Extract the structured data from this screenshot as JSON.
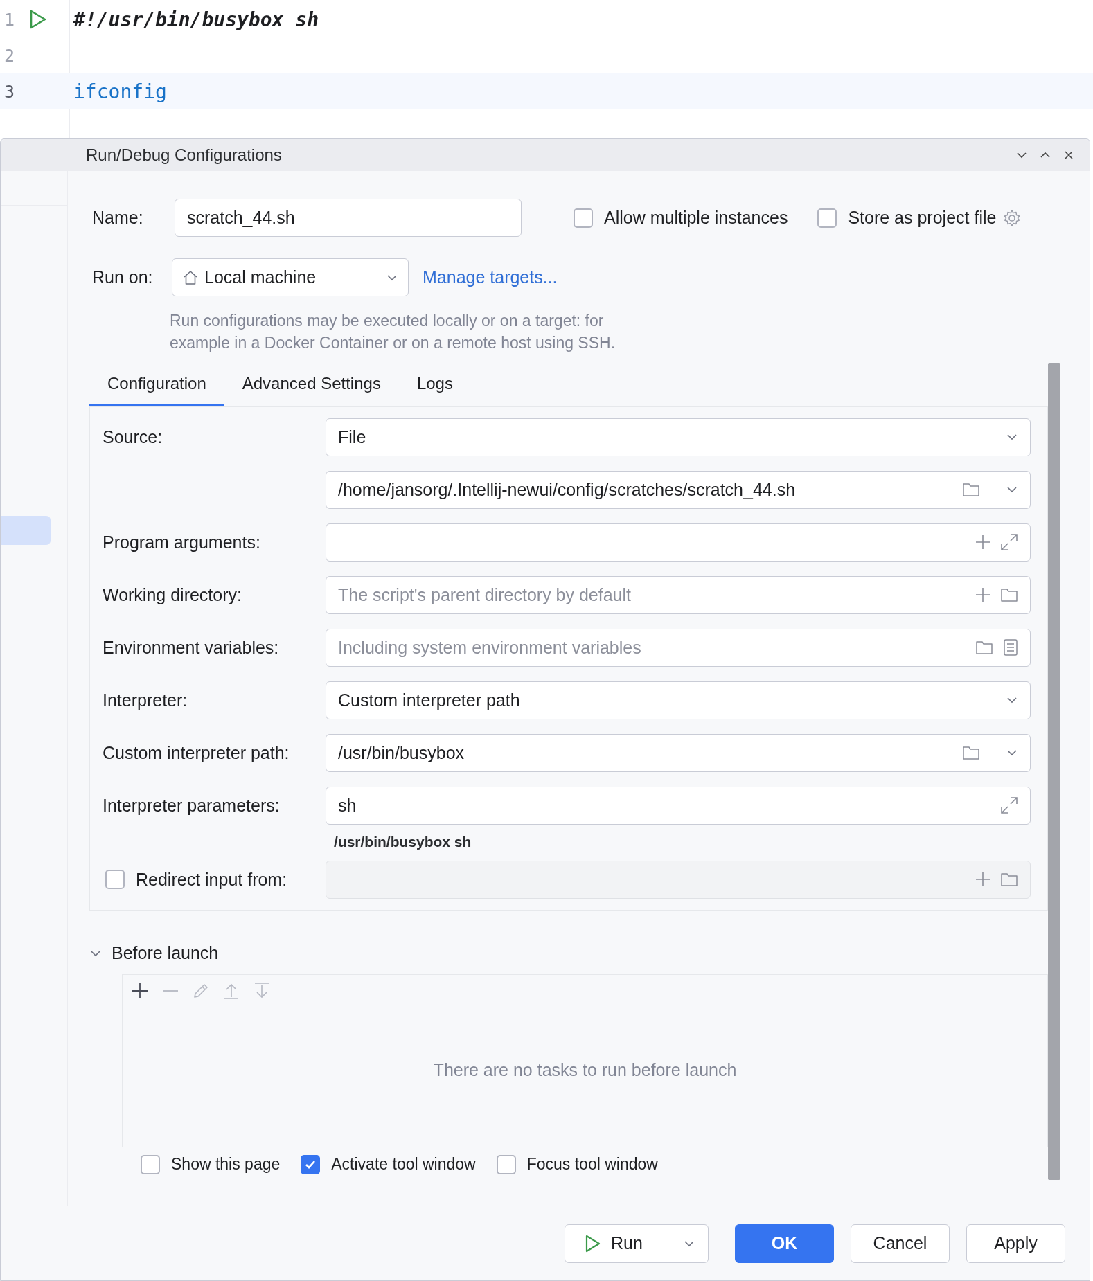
{
  "editor": {
    "lines": [
      {
        "number": "1",
        "text": "#!/usr/bin/busybox sh",
        "kind": "shebang",
        "runnable": true,
        "current": false
      },
      {
        "number": "2",
        "kind": "blank",
        "runnable": false,
        "current": false
      },
      {
        "number": "3",
        "text": "ifconfig",
        "kind": "command",
        "runnable": false,
        "current": true
      }
    ]
  },
  "dialog": {
    "title": "Run/Debug Configurations",
    "name": {
      "label": "Name:",
      "value": "scratch_44.sh"
    },
    "options": [
      {
        "label": "Allow multiple instances",
        "checked": false,
        "settings": false
      },
      {
        "label": "Store as project file",
        "checked": false,
        "settings": true
      }
    ],
    "run_on": {
      "label": "Run on:",
      "value": "Local machine",
      "link": "Manage targets..."
    },
    "help_text": "Run configurations may be executed locally or on a target: for example in a Docker Container or on a remote host using SSH.",
    "tabs": [
      {
        "label": "Configuration",
        "selected": true
      },
      {
        "label": "Advanced Settings",
        "selected": false
      },
      {
        "label": "Logs",
        "selected": false
      }
    ],
    "rows": [
      {
        "kind": "select",
        "label": "Source:",
        "value": "File"
      },
      {
        "kind": "path",
        "value": "/home/jansorg/.Intellij-newui/config/scratches/scratch_44.sh"
      },
      {
        "kind": "args",
        "label": "Program arguments:"
      },
      {
        "kind": "dir",
        "label": "Working directory:",
        "placeholder": "The script's parent directory by default"
      },
      {
        "kind": "env",
        "label": "Environment variables:",
        "placeholder": "Including system environment variables"
      },
      {
        "kind": "select",
        "label": "Interpreter:",
        "value": "Custom interpreter path"
      },
      {
        "kind": "path",
        "label": "Custom interpreter path:",
        "value": "/usr/bin/busybox"
      },
      {
        "kind": "expand",
        "label": "Interpreter parameters:",
        "value": "sh"
      },
      {
        "kind": "hint",
        "value": "/usr/bin/busybox sh"
      },
      {
        "kind": "redirect",
        "label": "Redirect input from:",
        "checked": false
      }
    ],
    "before_launch": {
      "title": "Before launch",
      "expanded": true,
      "empty_text": "There are no tasks to run before launch"
    },
    "launch_options": [
      {
        "label": "Show this page",
        "checked": false
      },
      {
        "label": "Activate tool window",
        "checked": true
      },
      {
        "label": "Focus tool window",
        "checked": false
      }
    ],
    "buttons": {
      "run": "Run",
      "ok": "OK",
      "cancel": "Cancel",
      "apply": "Apply"
    }
  }
}
